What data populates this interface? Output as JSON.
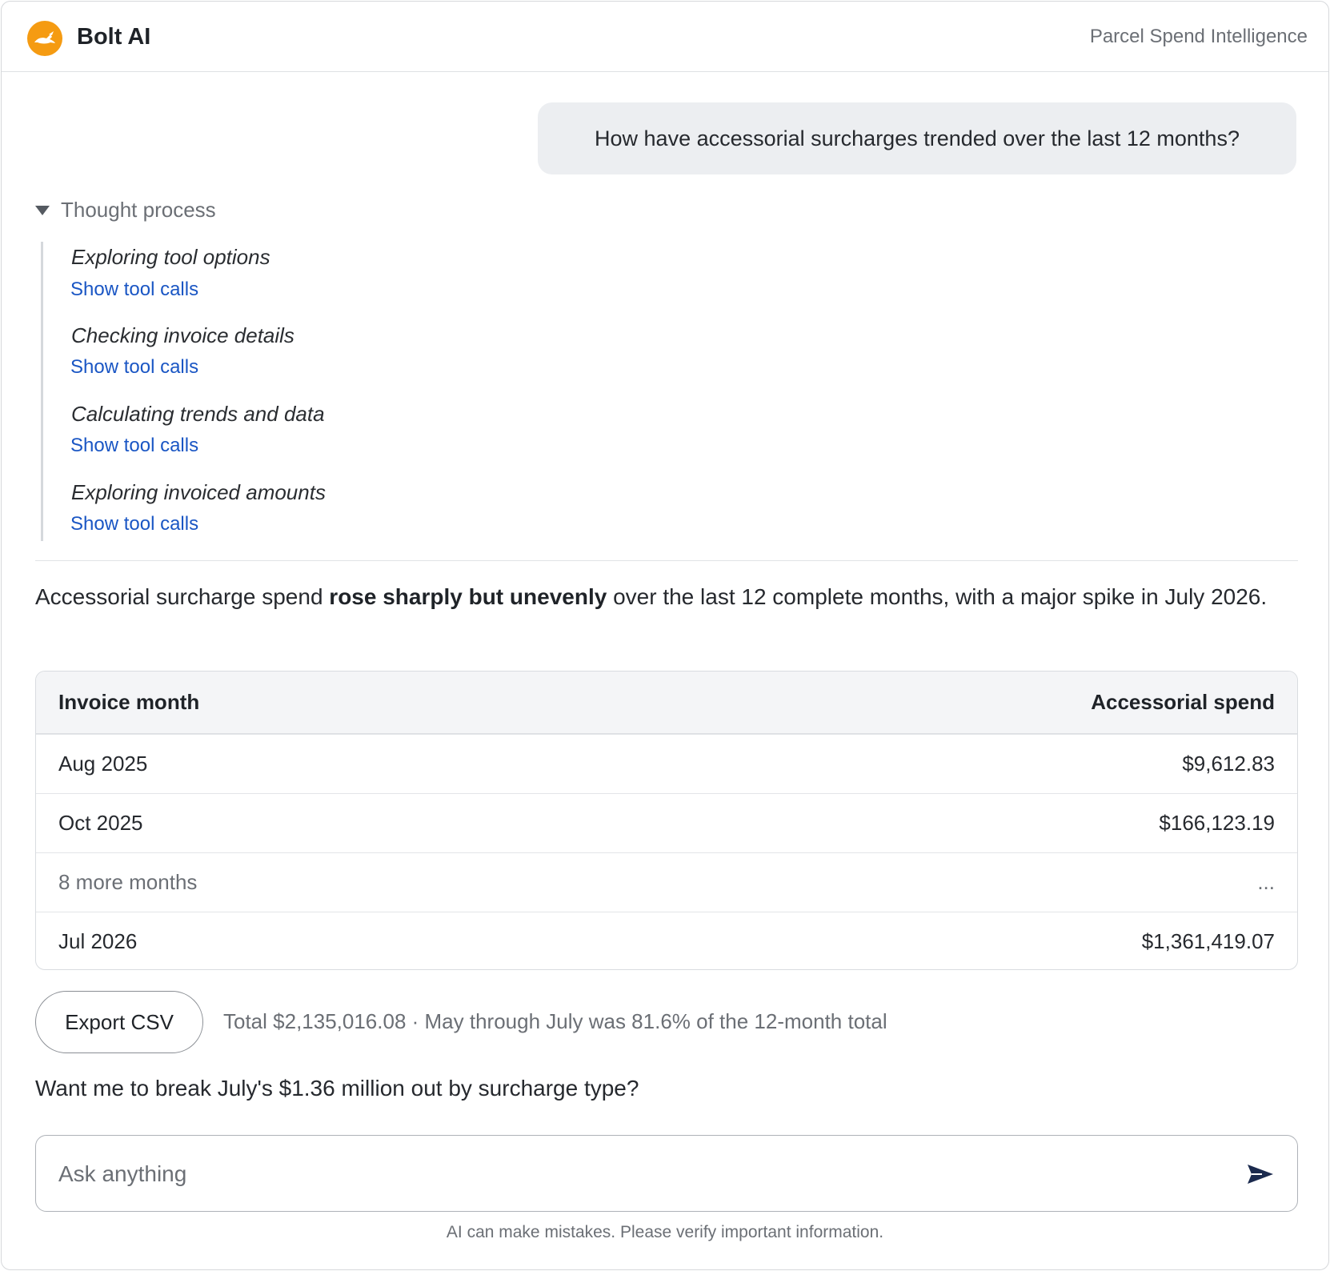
{
  "header": {
    "brand": "Bolt AI",
    "subtitle": "Parcel Spend Intelligence",
    "logo_icon": "rabbit-logo-icon",
    "logo_color": "#f59b12"
  },
  "user_message": "How have accessorial surcharges trended over the last 12 months?",
  "thought": {
    "label": "Thought process",
    "steps": [
      {
        "title": "Exploring tool options",
        "link": "Show tool calls"
      },
      {
        "title": "Checking invoice details",
        "link": "Show tool calls"
      },
      {
        "title": "Calculating trends and data",
        "link": "Show tool calls"
      },
      {
        "title": "Exploring invoiced amounts",
        "link": "Show tool calls"
      }
    ]
  },
  "summary": {
    "pre": "Accessorial surcharge spend ",
    "bold": "rose sharply but unevenly",
    "post": " over the last 12 complete months, with a major spike in July 2026."
  },
  "table": {
    "headers": [
      "Invoice month",
      "Accessorial spend"
    ],
    "rows": [
      [
        "Aug 2025",
        "$9,612.83"
      ],
      [
        "Oct 2025",
        "$166,123.19"
      ],
      [
        "8 more months",
        "..."
      ],
      [
        "Jul 2026",
        "$1,361,419.07"
      ]
    ]
  },
  "actions": {
    "export_label": "Export CSV",
    "total_note": "Total $2,135,016.08 · May through July was 81.6% of the 12-month total"
  },
  "followup": "Want me to break July's $1.36 million out by surcharge type?",
  "composer": {
    "placeholder": "Ask anything",
    "value": "",
    "send_icon": "send-icon"
  },
  "disclaimer": "AI can make mistakes. Please verify important information."
}
